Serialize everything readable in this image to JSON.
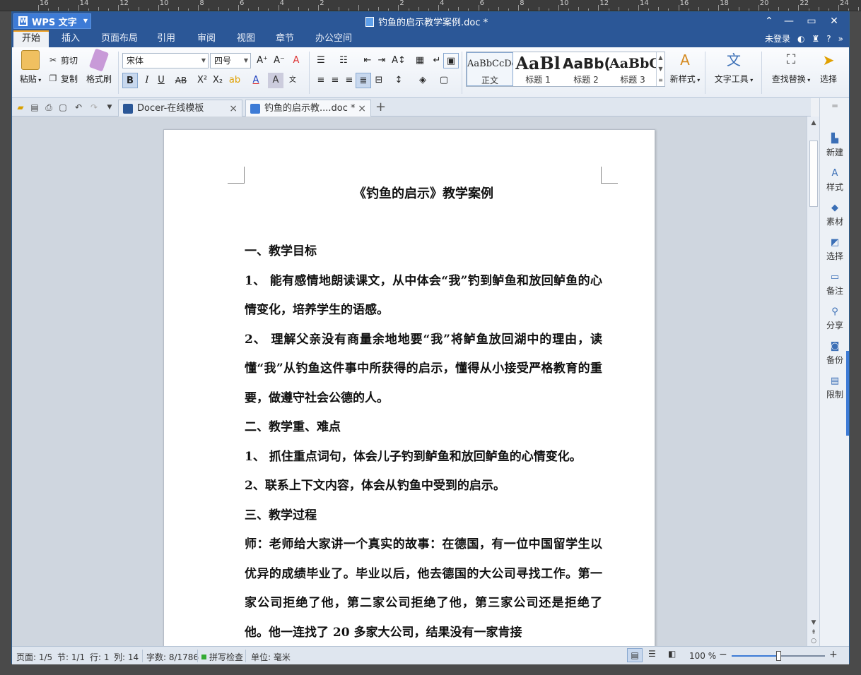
{
  "ruler": {
    "ticks": [
      "16",
      "14",
      "12",
      "10",
      "8",
      "6",
      "4",
      "2",
      "",
      "2",
      "4",
      "6",
      "8",
      "10",
      "12",
      "14",
      "16",
      "18",
      "20",
      "22",
      "24"
    ]
  },
  "app": {
    "name": "WPS 文字",
    "doc_title": "钓鱼的启示教学案例.doc *"
  },
  "menu": {
    "tabs": [
      "开始",
      "插入",
      "页面布局",
      "引用",
      "审阅",
      "视图",
      "章节",
      "办公空间"
    ],
    "active": "开始",
    "login": "未登录",
    "help": "?"
  },
  "ribbon": {
    "paste": "粘贴",
    "cut": "剪切",
    "copy": "复制",
    "format_painter": "格式刷",
    "font_name": "宋体",
    "font_size": "四号",
    "styles": [
      {
        "preview": "AaBbCcDd",
        "name": "正文"
      },
      {
        "preview": "AaBl",
        "name": "标题 1"
      },
      {
        "preview": "AaBb(",
        "name": "标题 2"
      },
      {
        "preview": "AaBbC",
        "name": "标题 3"
      }
    ],
    "new_style": "新样式",
    "text_tools": "文字工具",
    "find_replace": "查找替换",
    "select": "选择"
  },
  "tabs": [
    {
      "label": "Docer-在线模板",
      "active": false
    },
    {
      "label": "钓鱼的启示教....doc *",
      "active": true
    }
  ],
  "document": {
    "title": "《钓鱼的启示》教学案例",
    "paragraphs": [
      "一、教学目标",
      "1、 能有感情地朗读课文，从中体会“我”钓到鲈鱼和放回鲈鱼的心情变化，培养学生的语感。",
      "2、 理解父亲没有商量余地地要“我”将鲈鱼放回湖中的理由，读懂“我”从钓鱼这件事中所获得的启示，懂得从小接受严格教育的重要，做遵守社会公德的人。",
      "二、教学重、难点",
      "1、 抓住重点词句，体会儿子钓到鲈鱼和放回鲈鱼的心情变化。",
      "2、联系上下文内容，体会从钓鱼中受到的启示。",
      "三、教学过程",
      "师：老师给大家讲一个真实的故事：在德国，有一位中国留学生以优异的成绩毕业了。毕业以后，他去德国的大公司寻找工作。第一家公司拒绝了他，第二家公司拒绝了他，第三家公司还是拒绝了他。他一连找了 20 多家大公司，结果没有一家肯接"
    ]
  },
  "side_panel": [
    "新建",
    "样式",
    "素材",
    "选择",
    "备注",
    "分享",
    "备份",
    "限制"
  ],
  "status": {
    "page": "页面: 1/5",
    "section": "节: 1/1",
    "line": "行: 1",
    "column": "列: 14",
    "words": "字数: 8/1786",
    "spell": "拼写检查",
    "unit": "单位: 毫米",
    "zoom": "100 %",
    "zoom_level": 0.5
  },
  "colors": {
    "titlebar": "#2b5797",
    "accent": "#3d7bd6",
    "tab_active_marker": "#f0a020"
  }
}
